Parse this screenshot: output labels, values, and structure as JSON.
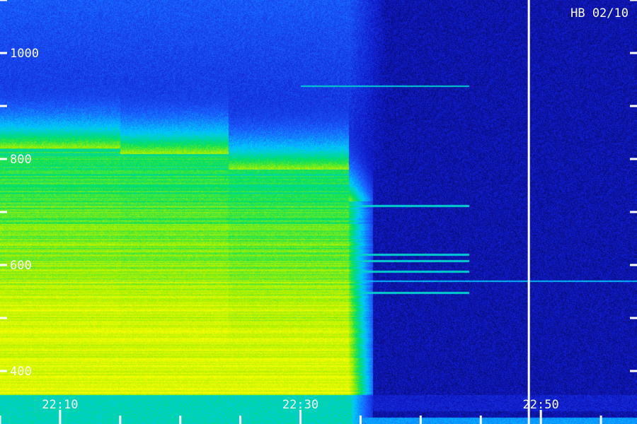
{
  "chart_data": {
    "type": "heatmap",
    "title": "HB 02/10",
    "xlabel": "",
    "ylabel": "",
    "x_tick_labels": [
      "22:10",
      "22:30",
      "22:50"
    ],
    "y_tick_labels": [
      "400",
      "600",
      "800",
      "1000"
    ],
    "x_range_min": [
      20.7,
      22.2
    ],
    "x_range_clock": [
      "22:05",
      "22:58"
    ],
    "y_range": [
      300,
      1100
    ],
    "grid": false,
    "legend": "none",
    "colormap": [
      "#000020",
      "#1018c8",
      "#1a5cff",
      "#00c8ff",
      "#00e060",
      "#a8f000",
      "#ffff00"
    ],
    "marker_time": "22:49",
    "events": [
      {
        "time_start": "22:05",
        "time_end": "22:15",
        "freq_top": 820,
        "level": "strong"
      },
      {
        "time_start": "22:15",
        "time_end": "22:24",
        "freq_top": 810,
        "level": "strong"
      },
      {
        "time_start": "22:24",
        "time_end": "22:34",
        "freq_top": 780,
        "level": "strong"
      },
      {
        "time_start": "22:34",
        "time_end": "22:36",
        "freq_top": 720,
        "level": "fading"
      }
    ],
    "carrier_lines_mhz": [
      938,
      712,
      620,
      608,
      588,
      548
    ],
    "persistent_line_mhz": 570
  }
}
